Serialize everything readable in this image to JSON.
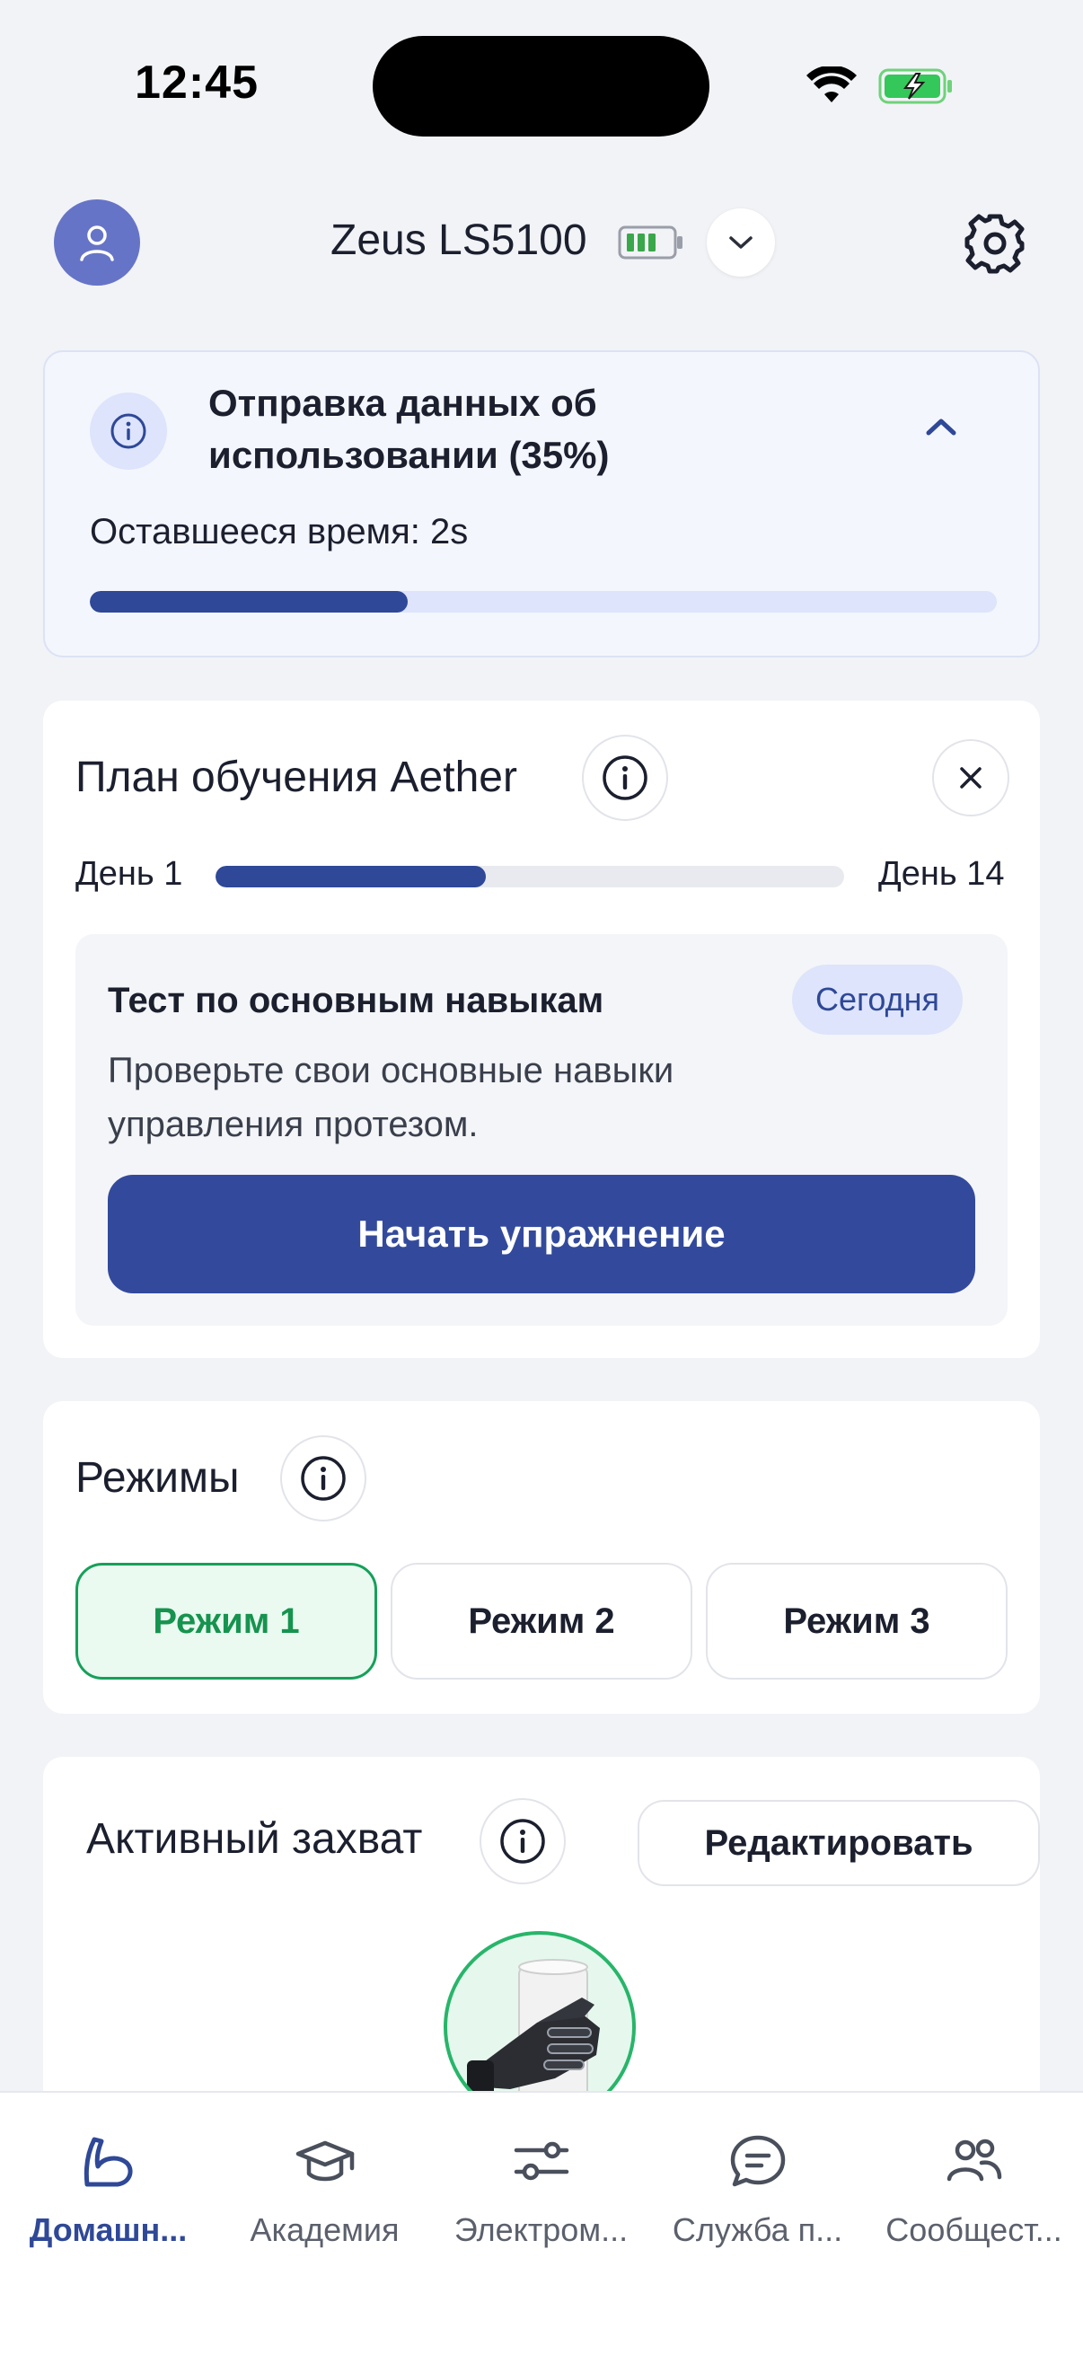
{
  "status_bar": {
    "time": "12:45"
  },
  "header": {
    "device_name": "Zeus LS5100"
  },
  "upload": {
    "title": "Отправка данных об использовании (35%)",
    "remaining": "Оставшееся время: 2s",
    "progress": 0.35
  },
  "plan": {
    "title": "План обучения Aether",
    "day_start": "День 1",
    "day_end": "День 14",
    "progress": 0.43,
    "exercise": {
      "title": "Тест по основным навыкам",
      "badge": "Сегодня",
      "description": "Проверьте свои основные навыки управления протезом.",
      "button": "Начать упражнение"
    }
  },
  "modes": {
    "title": "Режимы",
    "items": [
      {
        "label": "Режим 1",
        "active": true
      },
      {
        "label": "Режим 2",
        "active": false
      },
      {
        "label": "Режим 3",
        "active": false
      }
    ]
  },
  "grip": {
    "title": "Активный захват",
    "edit_button": "Редактировать"
  },
  "tabs": [
    {
      "label": "Домашн...",
      "icon": "arm-icon",
      "active": true
    },
    {
      "label": "Академия",
      "icon": "graduation-cap-icon",
      "active": false
    },
    {
      "label": "Электром...",
      "icon": "sliders-icon",
      "active": false
    },
    {
      "label": "Служба п...",
      "icon": "chat-icon",
      "active": false
    },
    {
      "label": "Сообщест...",
      "icon": "community-icon",
      "active": false
    }
  ],
  "colors": {
    "primary": "#334a9c",
    "accent_green": "#16a05a",
    "background": "#f2f3f7",
    "badge_bg": "#dde4fb"
  }
}
